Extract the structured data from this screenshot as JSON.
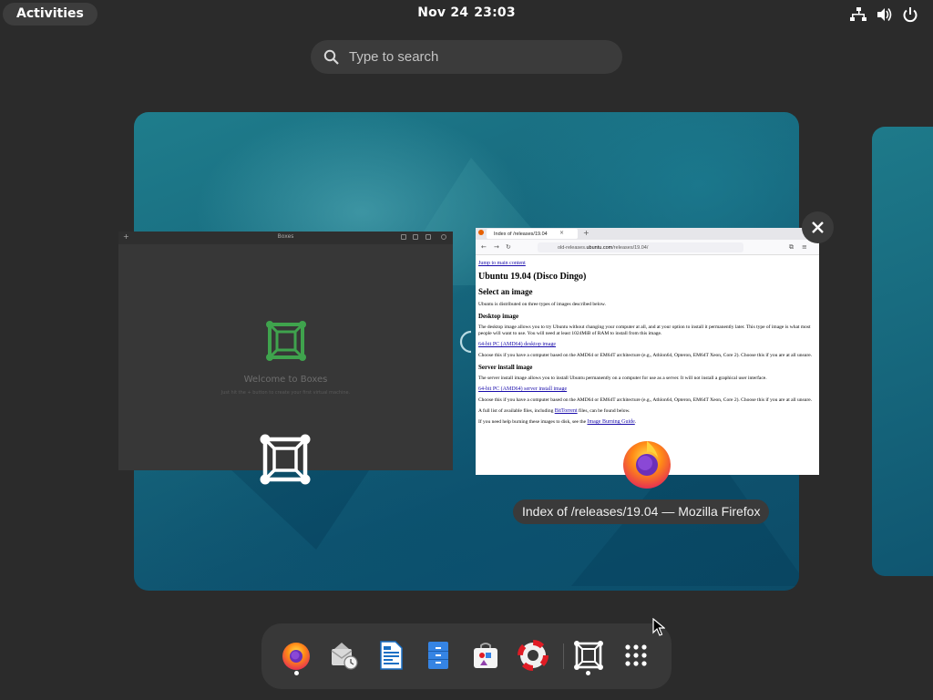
{
  "topbar": {
    "activities_label": "Activities",
    "date": "Nov 24",
    "time": "23:03",
    "tray_icons": [
      "network-icon",
      "volume-icon",
      "power-icon"
    ]
  },
  "search": {
    "placeholder": "Type to search"
  },
  "windows": {
    "boxes": {
      "title": "Boxes",
      "welcome": "Welcome to Boxes",
      "subtitle": "Just hit the + button to create your first virtual machine."
    },
    "firefox": {
      "tab_title": "Index of /releases/19.04",
      "url_prefix": "old-releases.",
      "url_host": "ubuntu.com",
      "url_path": "/releases/19.04/",
      "jump_link": "Jump to main content",
      "heading": "Ubuntu 19.04 (Disco Dingo)",
      "select_heading": "Select an image",
      "intro": "Ubuntu is distributed on three types of images described below.",
      "desktop_heading": "Desktop image",
      "desktop_text": "The desktop image allows you to try Ubuntu without changing your computer at all, and at your option to install it permanently later. This type of image is what most people will want to use. You will need at least 1024MiB of RAM to install from this image.",
      "desktop_link": "64-bit PC (AMD64) desktop image",
      "desktop_choose": "Choose this if you have a computer based on the AMD64 or EM64T architecture (e.g., Athlon64, Opteron, EM64T Xeon, Core 2). Choose this if you are at all unsure.",
      "server_heading": "Server install image",
      "server_text": "The server install image allows you to install Ubuntu permanently on a computer for use as a server. It will not install a graphical user interface.",
      "server_link": "64-bit PC (AMD64) server install image",
      "server_choose": "Choose this if you have a computer based on the AMD64 or EM64T architecture (e.g., Athlon64, Opteron, EM64T Xeon, Core 2). Choose this if you are at all unsure.",
      "full_list_prefix": "A full list of available files, including ",
      "bittorrent_link": "BitTorrent",
      "full_list_suffix": " files, can be found below.",
      "help_prefix": "If you need help burning these images to disk, see the ",
      "help_link": "Image Burning Guide",
      "help_suffix": "."
    }
  },
  "tooltip": "Index of /releases/19.04 — Mozilla Firefox",
  "dock": {
    "items": [
      {
        "name": "firefox",
        "icon": "firefox-icon",
        "running": true
      },
      {
        "name": "evolution",
        "icon": "mail-clock-icon",
        "running": false
      },
      {
        "name": "writer",
        "icon": "document-icon",
        "running": false
      },
      {
        "name": "files",
        "icon": "cabinet-icon",
        "running": false
      },
      {
        "name": "software",
        "icon": "software-bag-icon",
        "running": false
      },
      {
        "name": "help",
        "icon": "lifebuoy-icon",
        "running": false
      },
      {
        "name": "boxes",
        "icon": "boxes-icon",
        "running": true
      },
      {
        "name": "app-grid",
        "icon": "grid-icon",
        "running": false
      }
    ]
  },
  "colors": {
    "accent": "#3584e4",
    "workspace": "#17697e",
    "panel": "#2b2b2b"
  }
}
